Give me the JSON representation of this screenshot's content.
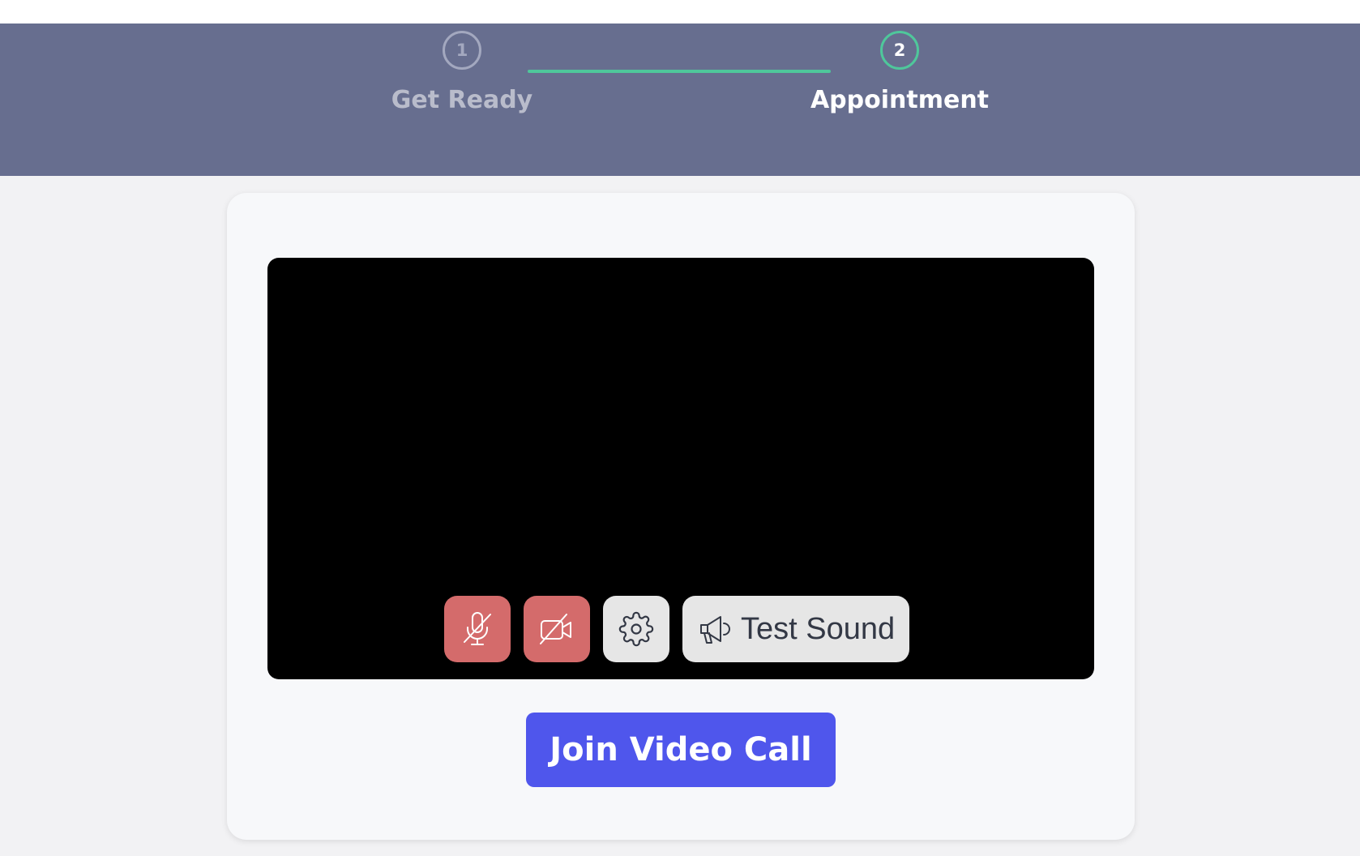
{
  "colors": {
    "header_bg": "#676e8f",
    "accent_green": "#4fc79b",
    "muted_red": "#d46b6b",
    "primary_button": "#4f56ec",
    "video_bg": "#000000"
  },
  "stepper": {
    "steps": [
      {
        "number": "1",
        "label": "Get Ready",
        "state": "completed"
      },
      {
        "number": "2",
        "label": "Appointment",
        "state": "active"
      }
    ]
  },
  "video_preview": {
    "controls": {
      "microphone": {
        "icon": "mic-off-icon",
        "state": "muted"
      },
      "camera": {
        "icon": "camera-off-icon",
        "state": "off"
      },
      "settings": {
        "icon": "gear-icon"
      },
      "test_sound": {
        "icon": "megaphone-icon",
        "label": "Test Sound"
      }
    }
  },
  "actions": {
    "join_label": "Join Video Call"
  }
}
